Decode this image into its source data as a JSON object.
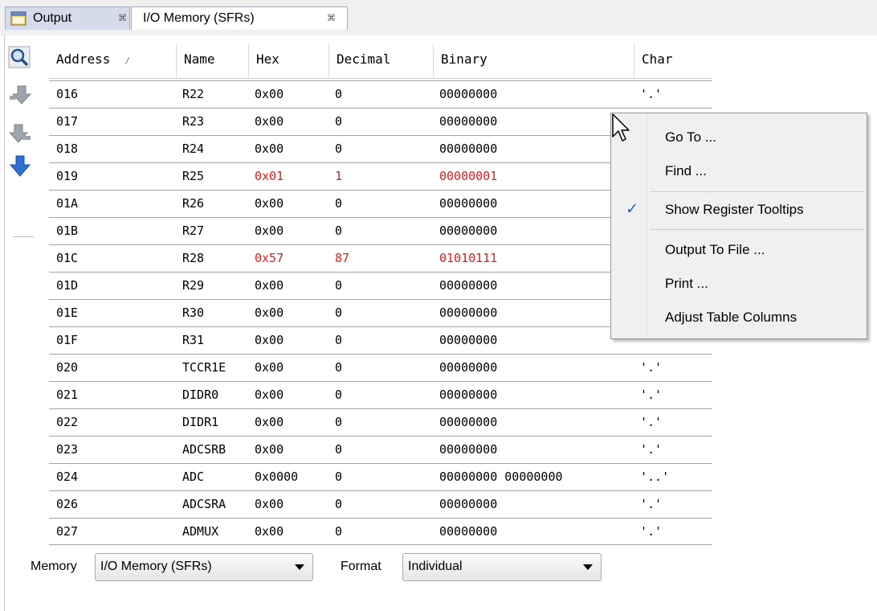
{
  "tabs": [
    {
      "label": "Output",
      "close": "⌘",
      "icon": "output-window-icon"
    },
    {
      "label": "I/O Memory (SFRs)",
      "close": "⌘"
    }
  ],
  "toolbar": {
    "icons": [
      "zoom-icon",
      "step-into-icon",
      "step-out-icon",
      "down-arrow-icon"
    ]
  },
  "table": {
    "columns": [
      {
        "label": "Address",
        "sort": "/"
      },
      {
        "label": "Name"
      },
      {
        "label": "Hex"
      },
      {
        "label": "Decimal"
      },
      {
        "label": "Binary"
      },
      {
        "label": "Char"
      }
    ],
    "rows": [
      {
        "address": "016",
        "name": "R22",
        "hex": "0x00",
        "decimal": "0",
        "binary": "00000000",
        "char": "'.'",
        "changed": false
      },
      {
        "address": "017",
        "name": "R23",
        "hex": "0x00",
        "decimal": "0",
        "binary": "00000000",
        "char": "",
        "changed": false
      },
      {
        "address": "018",
        "name": "R24",
        "hex": "0x00",
        "decimal": "0",
        "binary": "00000000",
        "char": "",
        "changed": false
      },
      {
        "address": "019",
        "name": "R25",
        "hex": "0x01",
        "decimal": "1",
        "binary": "00000001",
        "char": "",
        "changed": true
      },
      {
        "address": "01A",
        "name": "R26",
        "hex": "0x00",
        "decimal": "0",
        "binary": "00000000",
        "char": "",
        "changed": false
      },
      {
        "address": "01B",
        "name": "R27",
        "hex": "0x00",
        "decimal": "0",
        "binary": "00000000",
        "char": "",
        "changed": false
      },
      {
        "address": "01C",
        "name": "R28",
        "hex": "0x57",
        "decimal": "87",
        "binary": "01010111",
        "char": "",
        "changed": true
      },
      {
        "address": "01D",
        "name": "R29",
        "hex": "0x00",
        "decimal": "0",
        "binary": "00000000",
        "char": "",
        "changed": false
      },
      {
        "address": "01E",
        "name": "R30",
        "hex": "0x00",
        "decimal": "0",
        "binary": "00000000",
        "char": "",
        "changed": false
      },
      {
        "address": "01F",
        "name": "R31",
        "hex": "0x00",
        "decimal": "0",
        "binary": "00000000",
        "char": "",
        "changed": false
      },
      {
        "address": "020",
        "name": "TCCR1E",
        "hex": "0x00",
        "decimal": "0",
        "binary": "00000000",
        "char": "'.'",
        "changed": false
      },
      {
        "address": "021",
        "name": "DIDR0",
        "hex": "0x00",
        "decimal": "0",
        "binary": "00000000",
        "char": "'.'",
        "changed": false
      },
      {
        "address": "022",
        "name": "DIDR1",
        "hex": "0x00",
        "decimal": "0",
        "binary": "00000000",
        "char": "'.'",
        "changed": false
      },
      {
        "address": "023",
        "name": "ADCSRB",
        "hex": "0x00",
        "decimal": "0",
        "binary": "00000000",
        "char": "'.'",
        "changed": false
      },
      {
        "address": "024",
        "name": "ADC",
        "hex": "0x0000",
        "decimal": "0",
        "binary": "00000000 00000000",
        "char": "'..'",
        "changed": false
      },
      {
        "address": "026",
        "name": "ADCSRA",
        "hex": "0x00",
        "decimal": "0",
        "binary": "00000000",
        "char": "'.'",
        "changed": false
      },
      {
        "address": "027",
        "name": "ADMUX",
        "hex": "0x00",
        "decimal": "0",
        "binary": "00000000",
        "char": "'.'",
        "changed": false
      }
    ]
  },
  "bottom": {
    "memory_label": "Memory",
    "memory_value": "I/O Memory (SFRs)",
    "format_label": "Format",
    "format_value": "Individual"
  },
  "context_menu": {
    "items": [
      {
        "label": "Go To ...",
        "checked": false
      },
      {
        "label": "Find ...",
        "checked": false
      },
      {
        "label": "Show Register Tooltips",
        "checked": true,
        "check_glyph": "✓"
      },
      {
        "label": "Output To File ...",
        "checked": false
      },
      {
        "label": "Print ...",
        "checked": false
      },
      {
        "label": "Adjust Table Columns",
        "checked": false
      }
    ]
  },
  "colors": {
    "changed_value": "#e8191e",
    "tab_active_bg": "#ffffff",
    "tab_inactive_bg": "#d6dbe9",
    "menu_bg": "#f0f0f0",
    "check_color": "#1a5fd6"
  }
}
